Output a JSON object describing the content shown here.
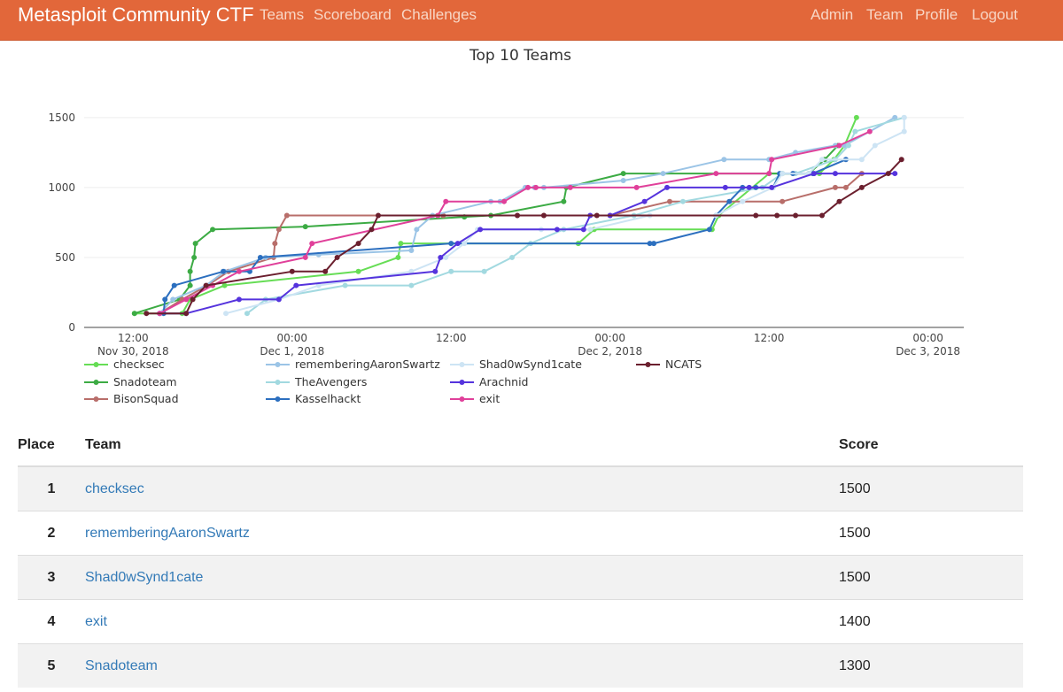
{
  "nav": {
    "brand": "Metasploit Community CTF",
    "left": [
      "Teams",
      "Scoreboard",
      "Challenges"
    ],
    "right": [
      "Admin",
      "Team",
      "Profile",
      "Logout"
    ]
  },
  "chart_data": {
    "type": "line",
    "title": "Top 10 Teams",
    "xlabel": "",
    "ylabel": "",
    "x_axis": "time",
    "ylim": [
      0,
      1600
    ],
    "y_ticks": [
      0,
      500,
      1000,
      1500
    ],
    "x_ticks": [
      {
        "t": 12,
        "label1": "12:00",
        "label2": "Nov 30, 2018"
      },
      {
        "t": 24,
        "label1": "00:00",
        "label2": "Dec 1, 2018"
      },
      {
        "t": 36,
        "label1": "12:00",
        "label2": ""
      },
      {
        "t": 48,
        "label1": "00:00",
        "label2": "Dec 2, 2018"
      },
      {
        "t": 60,
        "label1": "12:00",
        "label2": ""
      },
      {
        "t": 72,
        "label1": "00:00",
        "label2": "Dec 3, 2018"
      }
    ],
    "legend_placement": "bottom",
    "series": [
      {
        "name": "checksec",
        "color": "#66dd55",
        "points": [
          [
            12.1,
            100
          ],
          [
            15.7,
            100
          ],
          [
            16.3,
            200
          ],
          [
            18.9,
            300
          ],
          [
            29,
            400
          ],
          [
            32,
            500
          ],
          [
            32.2,
            600
          ],
          [
            45.6,
            600
          ],
          [
            46.8,
            700
          ],
          [
            55.7,
            700
          ],
          [
            56.2,
            800
          ],
          [
            60,
            1100
          ],
          [
            63.8,
            1100
          ],
          [
            64.9,
            1200
          ],
          [
            65.7,
            1300
          ],
          [
            66.6,
            1500
          ]
        ]
      },
      {
        "name": "Snadoteam",
        "color": "#3cab44",
        "points": [
          [
            12.1,
            100
          ],
          [
            15.5,
            200
          ],
          [
            16.3,
            300
          ],
          [
            16.3,
            400
          ],
          [
            16.6,
            500
          ],
          [
            16.7,
            600
          ],
          [
            18,
            700
          ],
          [
            25,
            720
          ],
          [
            37,
            790
          ],
          [
            39,
            800
          ],
          [
            44.5,
            900
          ],
          [
            44.7,
            1000
          ],
          [
            49,
            1100
          ],
          [
            61,
            1100
          ],
          [
            63,
            1100
          ],
          [
            64.2,
            1200
          ],
          [
            65.2,
            1300
          ]
        ]
      },
      {
        "name": "BisonSquad",
        "color": "#b86e6a",
        "points": [
          [
            14,
            100
          ],
          [
            15.7,
            200
          ],
          [
            17.6,
            300
          ],
          [
            19.2,
            400
          ],
          [
            22.6,
            500
          ],
          [
            22.7,
            600
          ],
          [
            23,
            700
          ],
          [
            23.6,
            800
          ],
          [
            35.4,
            800
          ],
          [
            41,
            800
          ],
          [
            43,
            800
          ],
          [
            48,
            800
          ],
          [
            52.5,
            900
          ],
          [
            61,
            900
          ],
          [
            65,
            1000
          ],
          [
            65.8,
            1000
          ],
          [
            67,
            1100
          ]
        ]
      },
      {
        "name": "rememberingAaronSwartz",
        "color": "#9bc4e6",
        "points": [
          [
            14,
            100
          ],
          [
            15,
            200
          ],
          [
            17.5,
            300
          ],
          [
            18.9,
            400
          ],
          [
            22,
            500
          ],
          [
            26,
            520
          ],
          [
            33,
            550
          ],
          [
            33.4,
            700
          ],
          [
            34.6,
            800
          ],
          [
            39,
            900
          ],
          [
            39.7,
            900
          ],
          [
            41.6,
            1000
          ],
          [
            42.3,
            1000
          ],
          [
            43,
            1000
          ],
          [
            49,
            1050
          ],
          [
            52,
            1100
          ],
          [
            56.6,
            1200
          ],
          [
            60,
            1200
          ],
          [
            62,
            1250
          ],
          [
            65,
            1300
          ],
          [
            65.7,
            1300
          ],
          [
            69.5,
            1500
          ]
        ]
      },
      {
        "name": "TheAvengers",
        "color": "#a2d9e0",
        "points": [
          [
            20.6,
            100
          ],
          [
            22,
            200
          ],
          [
            28,
            300
          ],
          [
            33,
            300
          ],
          [
            36,
            400
          ],
          [
            38.5,
            400
          ],
          [
            40.6,
            500
          ],
          [
            42,
            600
          ],
          [
            44.5,
            700
          ],
          [
            49.8,
            800
          ],
          [
            53.5,
            900
          ],
          [
            59.5,
            1000
          ],
          [
            61,
            1100
          ],
          [
            62,
            1100
          ],
          [
            65,
            1200
          ],
          [
            66,
            1300
          ],
          [
            66.5,
            1400
          ],
          [
            70.2,
            1500
          ]
        ]
      },
      {
        "name": "Kasselhackt",
        "color": "#2c6fbf",
        "points": [
          [
            14.3,
            100
          ],
          [
            14.4,
            200
          ],
          [
            15.1,
            300
          ],
          [
            18.8,
            400
          ],
          [
            20.8,
            400
          ],
          [
            21.6,
            500
          ],
          [
            36,
            600
          ],
          [
            51,
            600
          ],
          [
            51.3,
            600
          ],
          [
            55.5,
            700
          ],
          [
            56,
            800
          ],
          [
            57,
            900
          ],
          [
            58,
            1000
          ],
          [
            59,
            1000
          ],
          [
            60.3,
            1000
          ],
          [
            60.8,
            1100
          ],
          [
            61.8,
            1100
          ],
          [
            63.3,
            1100
          ],
          [
            65.8,
            1200
          ]
        ]
      },
      {
        "name": "Shad0wSynd1cate",
        "color": "#cde4f4",
        "points": [
          [
            19,
            100
          ],
          [
            23,
            200
          ],
          [
            26,
            300
          ],
          [
            33,
            400
          ],
          [
            35.6,
            500
          ],
          [
            37,
            600
          ],
          [
            38,
            700
          ],
          [
            42.8,
            700
          ],
          [
            46.5,
            700
          ],
          [
            51,
            800
          ],
          [
            56,
            800
          ],
          [
            58,
            900
          ],
          [
            60.3,
            1000
          ],
          [
            61,
            1100
          ],
          [
            63,
            1100
          ],
          [
            64,
            1200
          ],
          [
            67,
            1200
          ],
          [
            68,
            1300
          ],
          [
            70.2,
            1400
          ],
          [
            70.2,
            1500
          ]
        ]
      },
      {
        "name": "Arachnid",
        "color": "#5533dd",
        "points": [
          [
            14,
            100
          ],
          [
            16,
            100
          ],
          [
            20,
            200
          ],
          [
            23,
            200
          ],
          [
            24.3,
            300
          ],
          [
            34.8,
            400
          ],
          [
            35.2,
            500
          ],
          [
            36.5,
            600
          ],
          [
            38.2,
            700
          ],
          [
            44,
            700
          ],
          [
            46,
            700
          ],
          [
            46.5,
            800
          ],
          [
            48,
            800
          ],
          [
            50.6,
            900
          ],
          [
            52.3,
            1000
          ],
          [
            56.7,
            1000
          ],
          [
            58.5,
            1000
          ],
          [
            60.2,
            1000
          ],
          [
            63.4,
            1100
          ],
          [
            65,
            1100
          ],
          [
            69.5,
            1100
          ]
        ]
      },
      {
        "name": "exit",
        "color": "#e0409a",
        "points": [
          [
            14,
            100
          ],
          [
            16,
            200
          ],
          [
            18,
            300
          ],
          [
            20,
            400
          ],
          [
            25,
            500
          ],
          [
            25.5,
            600
          ],
          [
            35,
            800
          ],
          [
            35.6,
            900
          ],
          [
            40,
            900
          ],
          [
            41.8,
            1000
          ],
          [
            42.4,
            1000
          ],
          [
            45,
            1000
          ],
          [
            50,
            1000
          ],
          [
            56,
            1100
          ],
          [
            60,
            1100
          ],
          [
            60.2,
            1200
          ],
          [
            65.3,
            1300
          ],
          [
            67.6,
            1400
          ]
        ]
      },
      {
        "name": "NCATS",
        "color": "#6b1f2e",
        "points": [
          [
            13,
            100
          ],
          [
            16,
            100
          ],
          [
            16.5,
            200
          ],
          [
            17.5,
            300
          ],
          [
            24,
            400
          ],
          [
            26.5,
            400
          ],
          [
            27.4,
            500
          ],
          [
            29,
            600
          ],
          [
            30,
            700
          ],
          [
            30.5,
            800
          ],
          [
            41,
            800
          ],
          [
            43,
            800
          ],
          [
            47,
            800
          ],
          [
            59,
            800
          ],
          [
            60.6,
            800
          ],
          [
            62,
            800
          ],
          [
            64,
            800
          ],
          [
            65.3,
            900
          ],
          [
            67,
            1000
          ],
          [
            69,
            1100
          ],
          [
            70,
            1200
          ]
        ]
      }
    ]
  },
  "table": {
    "headers": {
      "place": "Place",
      "team": "Team",
      "score": "Score"
    },
    "rows": [
      {
        "place": "1",
        "team": "checksec",
        "score": "1500"
      },
      {
        "place": "2",
        "team": "rememberingAaronSwartz",
        "score": "1500"
      },
      {
        "place": "3",
        "team": "Shad0wSynd1cate",
        "score": "1500"
      },
      {
        "place": "4",
        "team": "exit",
        "score": "1400"
      },
      {
        "place": "5",
        "team": "Snadoteam",
        "score": "1300"
      }
    ]
  }
}
